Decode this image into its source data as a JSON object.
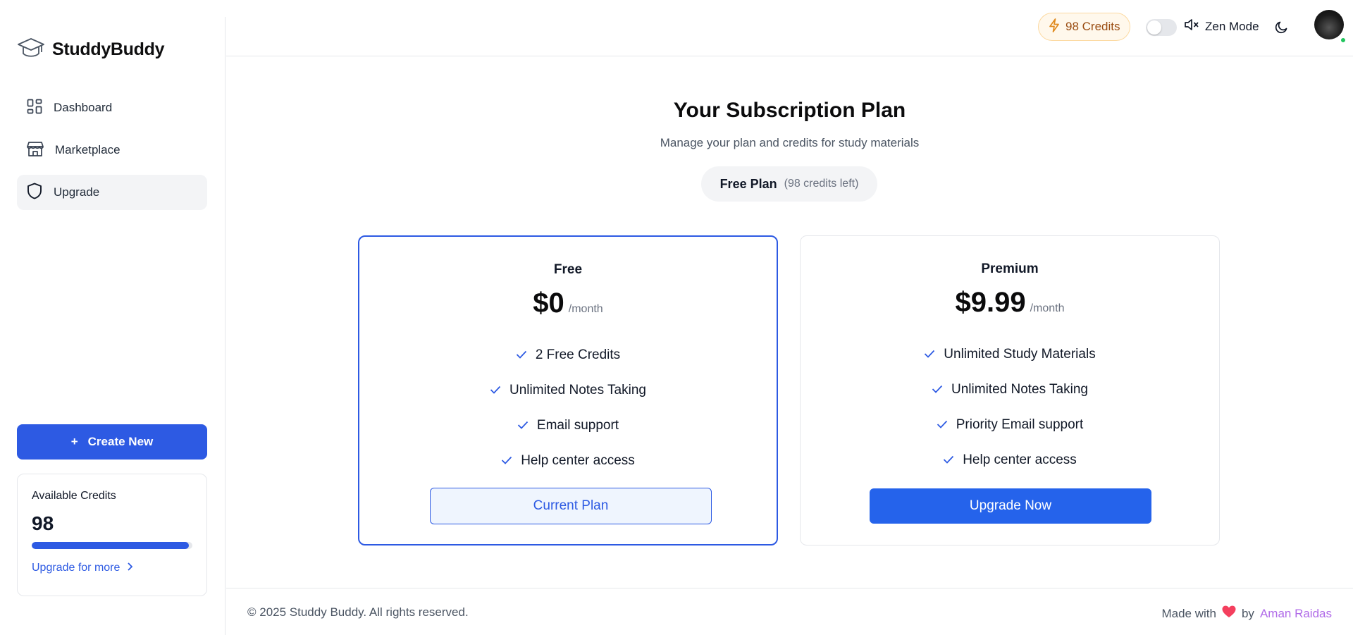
{
  "app": {
    "name": "StuddyBuddy"
  },
  "sidebar": {
    "items": [
      {
        "label": "Dashboard",
        "icon": "grid-icon",
        "active": false
      },
      {
        "label": "Marketplace",
        "icon": "store-icon",
        "active": false
      },
      {
        "label": "Upgrade",
        "icon": "shield-icon",
        "active": true
      }
    ],
    "create_button": {
      "icon": "+",
      "label": "Create New"
    },
    "credits_card": {
      "title": "Available Credits",
      "value": "98",
      "progress_fraction": 0.98,
      "link": "Upgrade for more"
    }
  },
  "header": {
    "credits_label": "98 Credits",
    "zen_mode": {
      "label": "Zen Mode",
      "enabled": false
    },
    "theme_icon": "moon-icon"
  },
  "main": {
    "title": "Your Subscription Plan",
    "subtitle": "Manage your plan and credits for study materials",
    "current_plan": {
      "name": "Free Plan",
      "credits_left": "(98 credits left)"
    },
    "plans": [
      {
        "name": "Free",
        "price": "$0",
        "period": "/month",
        "features": [
          "2 Free Credits",
          "Unlimited Notes Taking",
          "Email support",
          "Help center access"
        ],
        "button": "Current Plan"
      },
      {
        "name": "Premium",
        "price": "$9.99",
        "period": "/month",
        "features": [
          "Unlimited Study Materials",
          "Unlimited Notes Taking",
          "Priority Email support",
          "Help center access"
        ],
        "button": "Upgrade Now"
      }
    ]
  },
  "footer": {
    "copyright": "© 2025 Studdy Buddy. All rights reserved.",
    "made_with": "Made with",
    "by": "by",
    "author": "Aman Raidas"
  },
  "colors": {
    "accent": "#2d5ae3",
    "credits_pill_bg": "#fff8ec",
    "heart": "#f43f5e",
    "author_link": "#b06ae8",
    "online_dot": "#22c55e"
  }
}
